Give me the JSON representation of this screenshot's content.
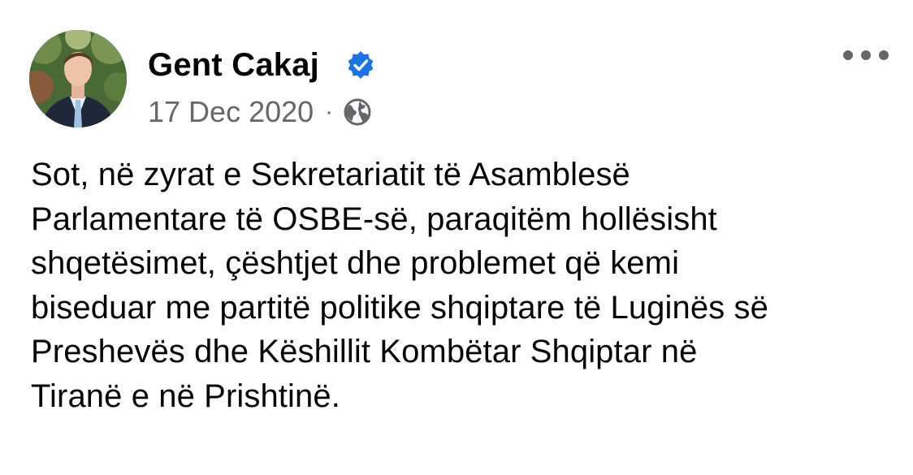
{
  "post": {
    "author": {
      "name": "Gent Cakaj",
      "verified": true,
      "avatar": "profile-photo"
    },
    "date": "17 Dec 2020",
    "separator": "·",
    "audience_icon": "globe-icon",
    "menu_icon": "more-options-icon",
    "text": "Sot, në zyrat e Sekretariatit të Asamblesë\nParlamentare të OSBE-së, paraqitëm hollësisht\nshqetësimet, çështjet dhe problemet që kemi\nbiseduar me partitë politike shqiptare të Luginës së\nPreshevës dhe Këshillit Kombëtar Shqiptar në\nTiranë e në Prishtinë."
  },
  "colors": {
    "text": "#050505",
    "secondary": "#65676b",
    "verified_blue": "#1b74e4",
    "background": "#ffffff"
  }
}
